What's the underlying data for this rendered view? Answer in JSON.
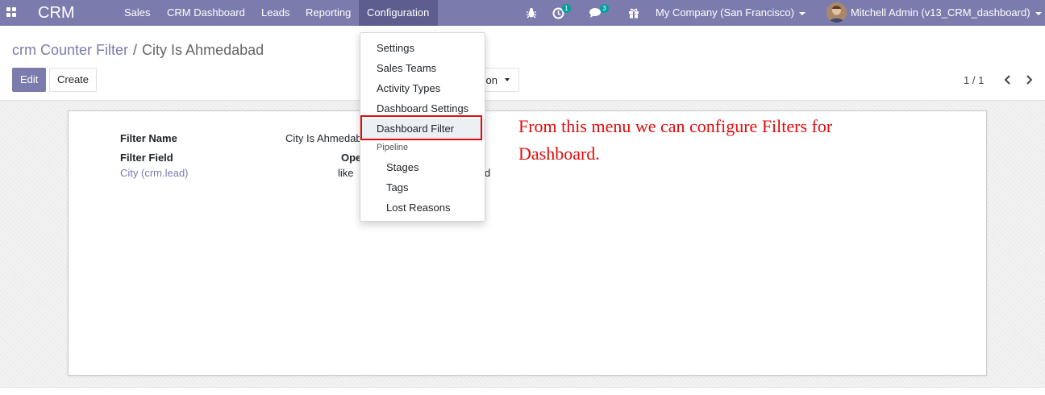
{
  "navbar": {
    "app_name": "CRM",
    "menu": [
      "Sales",
      "CRM Dashboard",
      "Leads",
      "Reporting",
      "Configuration"
    ],
    "activity_badge": "1",
    "messages_badge": "3",
    "company": "My Company (San Francisco)",
    "user": "Mitchell Admin (v13_CRM_dashboard)"
  },
  "breadcrumb": {
    "parent": "crm Counter Filter",
    "separator": "/",
    "current": "City Is Ahmedabad"
  },
  "buttons": {
    "edit": "Edit",
    "create": "Create",
    "action_fragment": "ion"
  },
  "pager": {
    "value": "1 / 1"
  },
  "record": {
    "filter_name_label": "Filter Name",
    "filter_name_value": "City Is Ahmedab",
    "filter_field_label": "Filter Field",
    "filter_field_value": "City (crm.lead)",
    "operator_label_fragment": "Ope",
    "operator_value": "like",
    "value_fragment": "d"
  },
  "dropdown": {
    "items": [
      "Settings",
      "Sales Teams",
      "Activity Types",
      "Dashboard Settings",
      "Dashboard Filter"
    ],
    "section_header": "Pipeline",
    "sub_items": [
      "Stages",
      "Tags",
      "Lost Reasons"
    ],
    "highlighted": "Dashboard Filter"
  },
  "annotation": {
    "line1": "From this menu we can configure Filters for",
    "line2": "Dashboard."
  },
  "colors": {
    "navbar": "#7c7bad",
    "navbar_active": "#5e5d8f",
    "badge": "#00a09d",
    "annotation": "#e20b0b",
    "link": "#7c7bad"
  }
}
